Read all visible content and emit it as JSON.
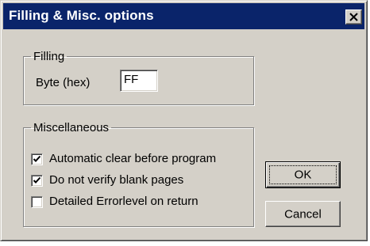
{
  "dialog": {
    "title": "Filling & Misc. options",
    "close_icon": "close-icon"
  },
  "filling": {
    "legend": "Filling",
    "byte_label": "Byte (hex)",
    "byte_value": "FF"
  },
  "misc": {
    "legend": "Miscellaneous",
    "options": [
      {
        "label": "Automatic clear before program",
        "checked": true
      },
      {
        "label": "Do not verify blank pages",
        "checked": true
      },
      {
        "label": "Detailed Errorlevel on return",
        "checked": false
      }
    ]
  },
  "buttons": {
    "ok": "OK",
    "cancel": "Cancel"
  }
}
